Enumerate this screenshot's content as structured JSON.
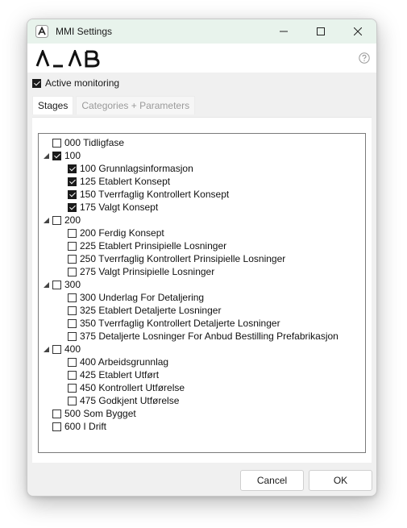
{
  "window": {
    "title": "MMI Settings"
  },
  "header": {
    "logo_text": "A L A B",
    "help_icon": "help-circle-icon"
  },
  "active_monitoring": {
    "label": "Active monitoring",
    "checked": true
  },
  "tabs": [
    {
      "label": "Stages",
      "active": true
    },
    {
      "label": "Categories + Parameters",
      "active": false
    }
  ],
  "tree": [
    {
      "label": "000 Tidligfase",
      "level": 0,
      "expander": false,
      "checked": false
    },
    {
      "label": "100",
      "level": 0,
      "expander": true,
      "checked": true
    },
    {
      "label": "100 Grunnlagsinformasjon",
      "level": 1,
      "expander": false,
      "checked": true
    },
    {
      "label": "125 Etablert Konsept",
      "level": 1,
      "expander": false,
      "checked": true
    },
    {
      "label": "150 Tverrfaglig Kontrollert Konsept",
      "level": 1,
      "expander": false,
      "checked": true
    },
    {
      "label": "175 Valgt Konsept",
      "level": 1,
      "expander": false,
      "checked": true
    },
    {
      "label": "200",
      "level": 0,
      "expander": true,
      "checked": false
    },
    {
      "label": "200 Ferdig Konsept",
      "level": 1,
      "expander": false,
      "checked": false
    },
    {
      "label": "225 Etablert Prinsipielle Losninger",
      "level": 1,
      "expander": false,
      "checked": false
    },
    {
      "label": "250 Tverrfaglig Kontrollert Prinsipielle Losninger",
      "level": 1,
      "expander": false,
      "checked": false
    },
    {
      "label": "275 Valgt Prinsipielle Losninger",
      "level": 1,
      "expander": false,
      "checked": false
    },
    {
      "label": "300",
      "level": 0,
      "expander": true,
      "checked": false
    },
    {
      "label": "300 Underlag For Detaljering",
      "level": 1,
      "expander": false,
      "checked": false
    },
    {
      "label": "325 Etablert Detaljerte Losninger",
      "level": 1,
      "expander": false,
      "checked": false
    },
    {
      "label": "350 Tverrfaglig Kontrollert Detaljerte Losninger",
      "level": 1,
      "expander": false,
      "checked": false
    },
    {
      "label": "375 Detaljerte Losninger For Anbud Bestilling Prefabrikasjon",
      "level": 1,
      "expander": false,
      "checked": false
    },
    {
      "label": "400",
      "level": 0,
      "expander": true,
      "checked": false
    },
    {
      "label": "400 Arbeidsgrunnlag",
      "level": 1,
      "expander": false,
      "checked": false
    },
    {
      "label": "425 Etablert Utført",
      "level": 1,
      "expander": false,
      "checked": false
    },
    {
      "label": "450 Kontrollert Utførelse",
      "level": 1,
      "expander": false,
      "checked": false
    },
    {
      "label": "475 Godkjent Utførelse",
      "level": 1,
      "expander": false,
      "checked": false
    },
    {
      "label": "500 Som Bygget",
      "level": 0,
      "expander": false,
      "checked": false
    },
    {
      "label": "600 I Drift",
      "level": 0,
      "expander": false,
      "checked": false
    }
  ],
  "footer": {
    "cancel_label": "Cancel",
    "ok_label": "OK"
  },
  "colors": {
    "titlebar": "#e8f3ec",
    "window_bg": "#f0f0f0",
    "checked": "#1b1b1b"
  }
}
